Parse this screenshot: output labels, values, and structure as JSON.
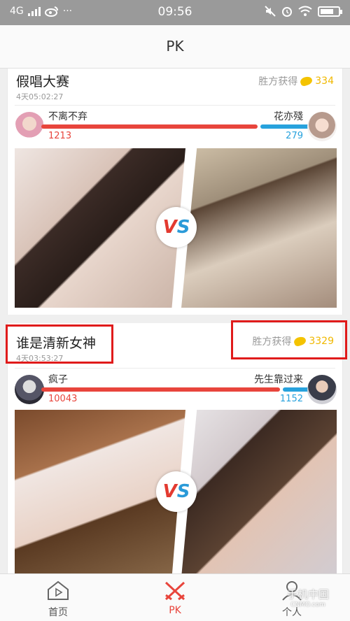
{
  "status_bar": {
    "network": "4G",
    "time": "09:56",
    "weibo_icon": "weibo-icon",
    "more": "···"
  },
  "header": {
    "title": "PK"
  },
  "cards": [
    {
      "title": "假唱大赛",
      "time_left": "4天05:02:27",
      "reward_label": "胜方获得",
      "reward_amount": "334",
      "left_name": "不离不弃",
      "right_name": "花亦殘",
      "left_score": "1213",
      "right_score": "279",
      "left_share": 0.813
    },
    {
      "title": "谁是清新女神",
      "time_left": "4天03:53:27",
      "reward_label": "胜方获得",
      "reward_amount": "3329",
      "left_name": "疯子",
      "right_name": "先生靠过来",
      "left_score": "10043",
      "right_score": "1152",
      "left_share": 0.897
    }
  ],
  "tabs": [
    {
      "label": "首页",
      "icon": "home-icon"
    },
    {
      "label": "PK",
      "icon": "crossed-swords-icon"
    },
    {
      "label": "个人",
      "icon": "person-icon"
    }
  ],
  "watermark": {
    "line1": "手机中国",
    "line2": "CNMO.com"
  },
  "colors": {
    "accent": "#e8453c",
    "blue": "#27a2dd",
    "gold": "#f0b800",
    "highlight": "#e01b1b"
  }
}
